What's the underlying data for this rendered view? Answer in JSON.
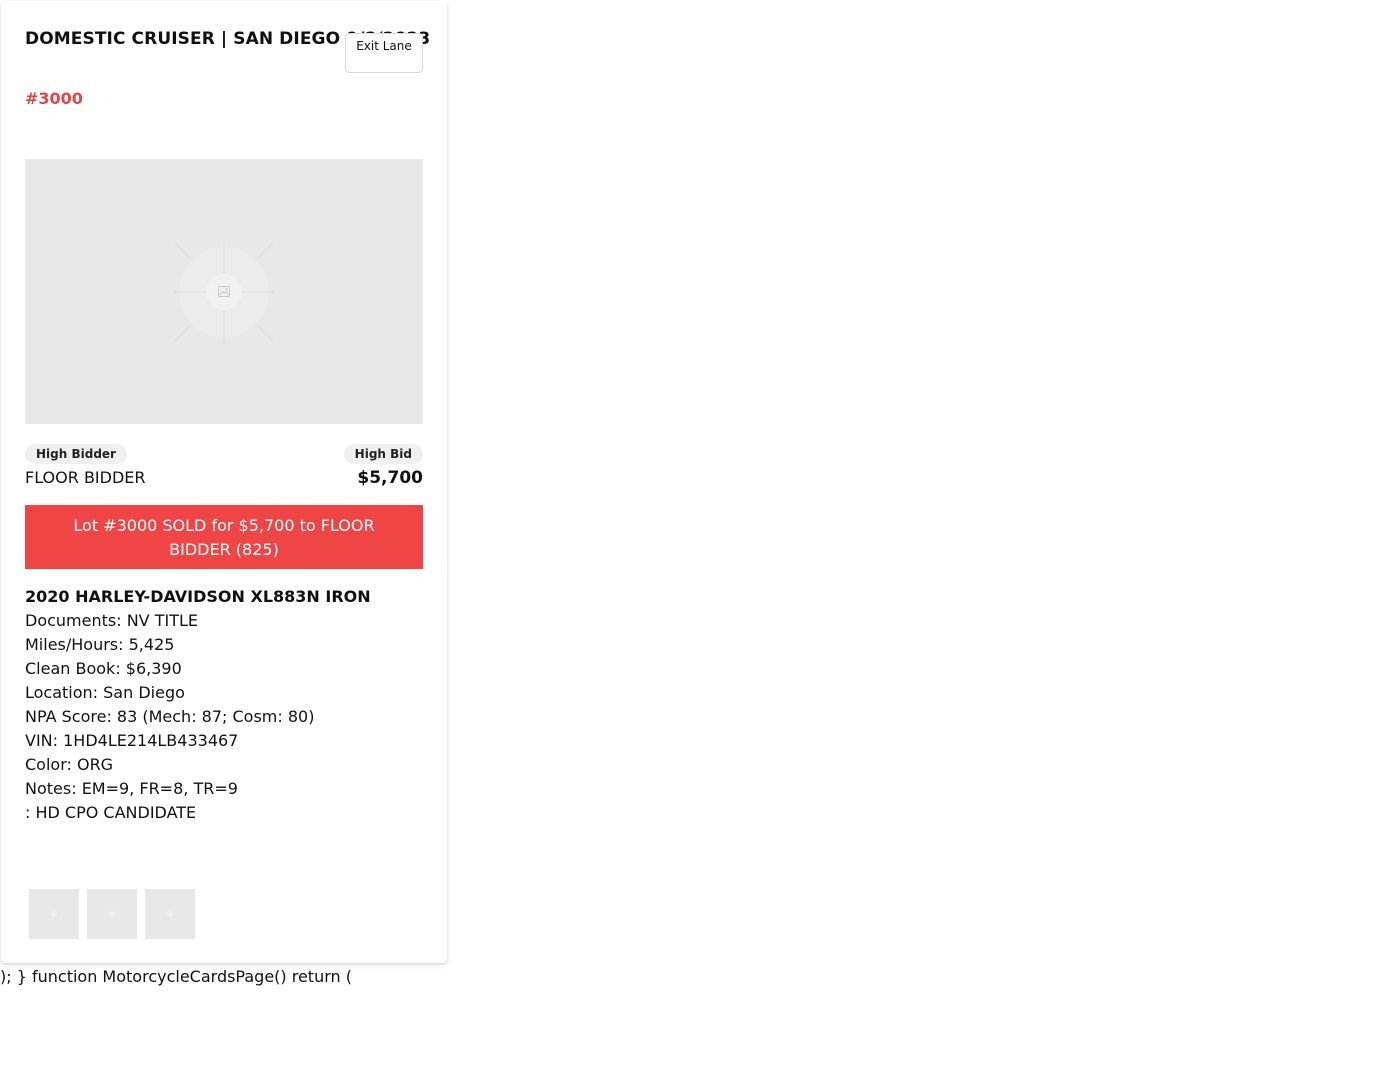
{
  "header": {
    "lane_title": "DOMESTIC CRUISER | SAN DIEGO 9/8/2023",
    "lot_number": "#3000",
    "exit_button_label": "Exit Lane"
  },
  "image": {
    "icon": "image-placeholder-icon"
  },
  "bidding": {
    "high_bidder_label": "High Bidder",
    "high_bidder_value": "FLOOR BIDDER",
    "high_bid_label": "High Bid",
    "high_bid_value": "$5,700"
  },
  "sold_banner": {
    "text": "Lot #3000 SOLD for $5,700 to FLOOR BIDDER (825)",
    "color": "#ef4545"
  },
  "vehicle": {
    "title": "2020 HARLEY-DAVIDSON XL883N IRON",
    "lines": [
      "Documents: NV TITLE",
      "Miles/Hours: 5,425",
      "Clean Book: $6,390",
      "Location: San Diego",
      "NPA Score: 83 (Mech: 87; Cosm: 80)",
      "VIN: 1HD4LE214LB433467",
      "Color: ORG",
      "Notes: EM=9, FR=8, TR=9",
      ": HD CPO CANDIDATE"
    ]
  },
  "thumbnails": {
    "count": 3
  },
  "stray_text": "); } function MotorcycleCardsPage() return (",
  "colors": {
    "accent_red": "#e04646",
    "placeholder_gray": "#e8e8e8",
    "pill_gray": "#efefef"
  }
}
